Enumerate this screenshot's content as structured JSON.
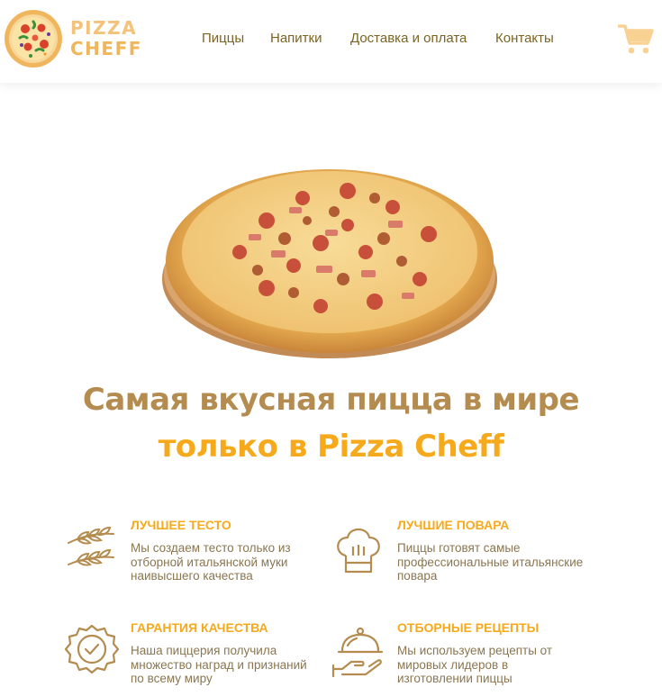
{
  "header": {
    "logo": {
      "line1": "PIZZA",
      "line2": "CHEFF"
    },
    "nav": [
      {
        "label": "Пиццы"
      },
      {
        "label": "Напитки"
      },
      {
        "label": "Доставка и оплата"
      },
      {
        "label": "Контакты"
      }
    ],
    "cart_icon": "shopping-cart-icon"
  },
  "hero": {
    "image": "meat-pizza-on-wooden-board",
    "headline_line1": "Самая вкусная пицца в мире",
    "headline_line2": "только в Pizza Cheff"
  },
  "features": [
    {
      "icon": "wheat-icon",
      "title": "ЛУЧШЕЕ ТЕСТО",
      "description": "Мы создаем тесто только из отборной итальянской муки наивысшего качества"
    },
    {
      "icon": "chef-hat-icon",
      "title": "ЛУЧШИЕ ПОВАРА",
      "description": "Пиццы готовят самые профессиональные итальянские повара"
    },
    {
      "icon": "quality-badge-icon",
      "title": "ГАРАНТИЯ КАЧЕСТВА",
      "description": "Наша пиццерия получила множество наград и признаний по всему миру"
    },
    {
      "icon": "serving-cloche-icon",
      "title": "ОТБОРНЫЕ РЕЦЕПТЫ",
      "description": "Мы используем рецепты от мировых лидеров в изготовлении пиццы"
    }
  ],
  "colors": {
    "brand_orange": "#f6a91b",
    "brand_brown": "#b48c50",
    "nav_text": "#7b6422",
    "body_text": "#8a7650",
    "cart": "#f8d193",
    "logo_light": "#f5c27b"
  }
}
